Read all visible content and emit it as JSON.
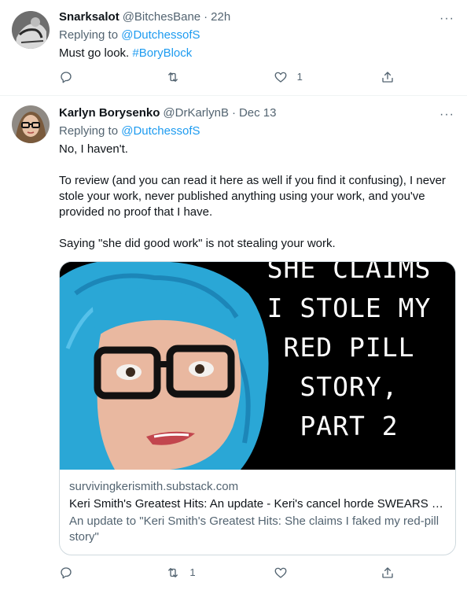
{
  "tweets": [
    {
      "name": "Snarksalot",
      "handle": "@BitchesBane",
      "time": "22h",
      "replying_prefix": "Replying to",
      "replying_to": "@DutchessofS",
      "text_plain": "Must go look. ",
      "hashtag": "#BoryBlock",
      "actions": {
        "reply": "",
        "retweet": "",
        "like": "1",
        "share": ""
      }
    },
    {
      "name": "Karlyn Borysenko",
      "handle": "@DrKarlynB",
      "time": "Dec 13",
      "replying_prefix": "Replying to",
      "replying_to": "@DutchessofS",
      "text": "No, I haven't.\n\nTo review (and you can read it here as well if you find it confusing), I never stole your work, never published anything using your work, and you've provided no proof that I have.\n\nSaying \"she did good work\" is not stealing your work.",
      "card": {
        "overlay_text": "SHE CLAIMS\nI STOLE MY\nRED PILL\nSTORY,\nPART 2",
        "domain": "survivingkerismith.substack.com",
        "title": "Keri Smith's Greatest Hits: An update - Keri's cancel horde SWEARS they...",
        "description": "An update to \"Keri Smith's Greatest Hits: She claims I faked my red-pill story\""
      },
      "actions": {
        "reply": "",
        "retweet": "1",
        "like": "",
        "share": ""
      }
    }
  ],
  "more_glyph": "···",
  "colors": {
    "link": "#1d9bf0",
    "secondary": "#536471",
    "border": "#cfd9de",
    "wig": "#2aa7d6"
  }
}
